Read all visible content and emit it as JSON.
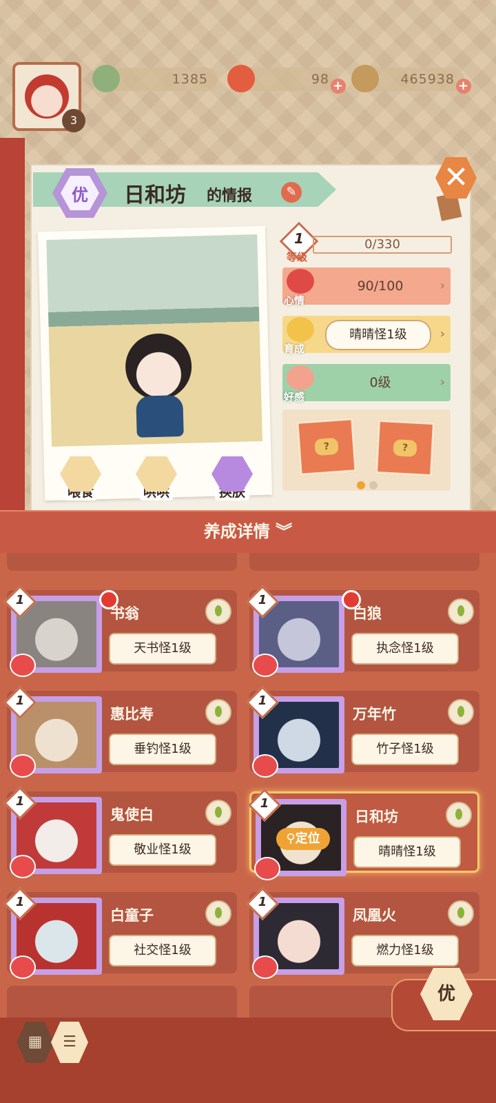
{
  "resources": {
    "jade": "1385",
    "gourd": "98",
    "coins": "465938"
  },
  "player": {
    "level": "3"
  },
  "info": {
    "rank": "优",
    "name": "日和坊",
    "name_suffix": "的情报",
    "level": "1",
    "exp": "0/330",
    "level_label": "等级",
    "mood_label": "心情",
    "mood": "90/100",
    "growth_label": "育成",
    "growth": "晴晴怪1级",
    "affinity_label": "好感",
    "affinity": "0级",
    "card_q": "?",
    "actions": [
      "喂食",
      "哄哄",
      "换肤"
    ]
  },
  "details_label": "养成详情",
  "list": [
    {
      "name": "书翁",
      "tag": "天书怪1级",
      "level": "1",
      "new": true,
      "colors": [
        "#d8d3cc",
        "#8a8480"
      ]
    },
    {
      "name": "白狼",
      "tag": "执念怪1级",
      "level": "1",
      "new": true,
      "colors": [
        "#c5c6d9",
        "#5b5f86"
      ]
    },
    {
      "name": "惠比寿",
      "tag": "垂钓怪1级",
      "level": "1",
      "new": false,
      "colors": [
        "#efe1cf",
        "#b9906a"
      ]
    },
    {
      "name": "万年竹",
      "tag": "竹子怪1级",
      "level": "1",
      "new": false,
      "colors": [
        "#cfd9e6",
        "#22304a"
      ]
    },
    {
      "name": "鬼使白",
      "tag": "敬业怪1级",
      "level": "1",
      "new": false,
      "colors": [
        "#f3ede9",
        "#c03a3a"
      ]
    },
    {
      "name": "日和坊",
      "tag": "晴晴怪1级",
      "level": "1",
      "new": false,
      "selected": true,
      "locate": "定位",
      "colors": [
        "#f0e2cf",
        "#2b2323"
      ]
    },
    {
      "name": "白童子",
      "tag": "社交怪1级",
      "level": "1",
      "new": false,
      "colors": [
        "#dbe6ea",
        "#b8332f"
      ]
    },
    {
      "name": "凤凰火",
      "tag": "燃力怪1级",
      "level": "1",
      "new": false,
      "colors": [
        "#f5dcd2",
        "#2e2a34"
      ]
    }
  ],
  "filter_label": "优",
  "colors": {
    "mood_bg": "#f4a88e",
    "growth_bg": "#f7d88a",
    "affinity_bg": "#9fd1a9",
    "panel": "#f5efe3",
    "list_bg": "#c9664a"
  }
}
